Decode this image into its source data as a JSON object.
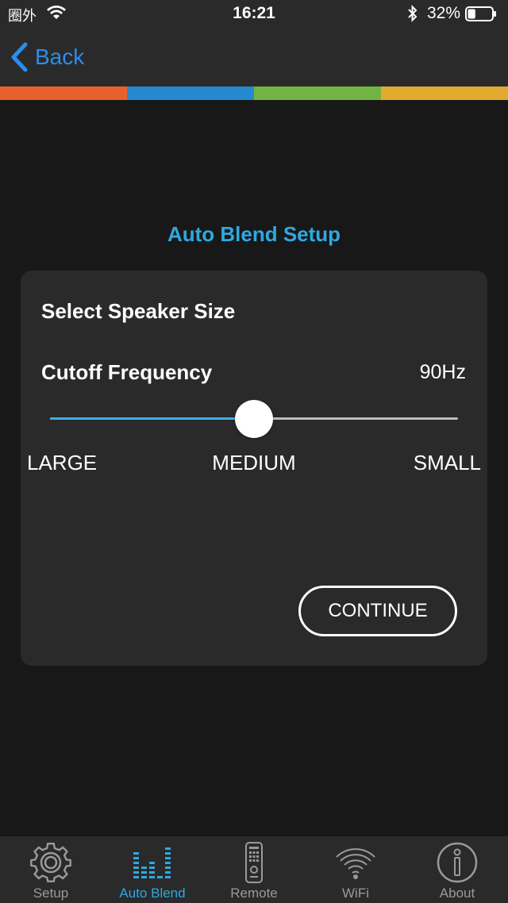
{
  "status_bar": {
    "carrier": "圈外",
    "time": "16:21",
    "battery": "32%",
    "battery_level": 0.32
  },
  "nav": {
    "back_label": "Back"
  },
  "colors": {
    "strip": [
      "#e8612c",
      "#2589d0",
      "#72b442",
      "#e2aa2e"
    ],
    "accent": "#2fa8e0",
    "link": "#2c8dea"
  },
  "page": {
    "title": "Auto Blend Setup"
  },
  "card": {
    "section_title": "Select Speaker Size",
    "freq_label": "Cutoff Frequency",
    "freq_value": "90Hz",
    "slider_value": 0.5,
    "size_labels": {
      "large": "LARGE",
      "medium": "MEDIUM",
      "small": "SMALL"
    },
    "continue_label": "CONTINUE"
  },
  "tabs": [
    {
      "label": "Setup",
      "icon": "gear-icon",
      "active": false
    },
    {
      "label": "Auto Blend",
      "icon": "equalizer-icon",
      "active": true
    },
    {
      "label": "Remote",
      "icon": "remote-icon",
      "active": false
    },
    {
      "label": "WiFi",
      "icon": "wifi-icon",
      "active": false
    },
    {
      "label": "About",
      "icon": "info-icon",
      "active": false
    }
  ]
}
